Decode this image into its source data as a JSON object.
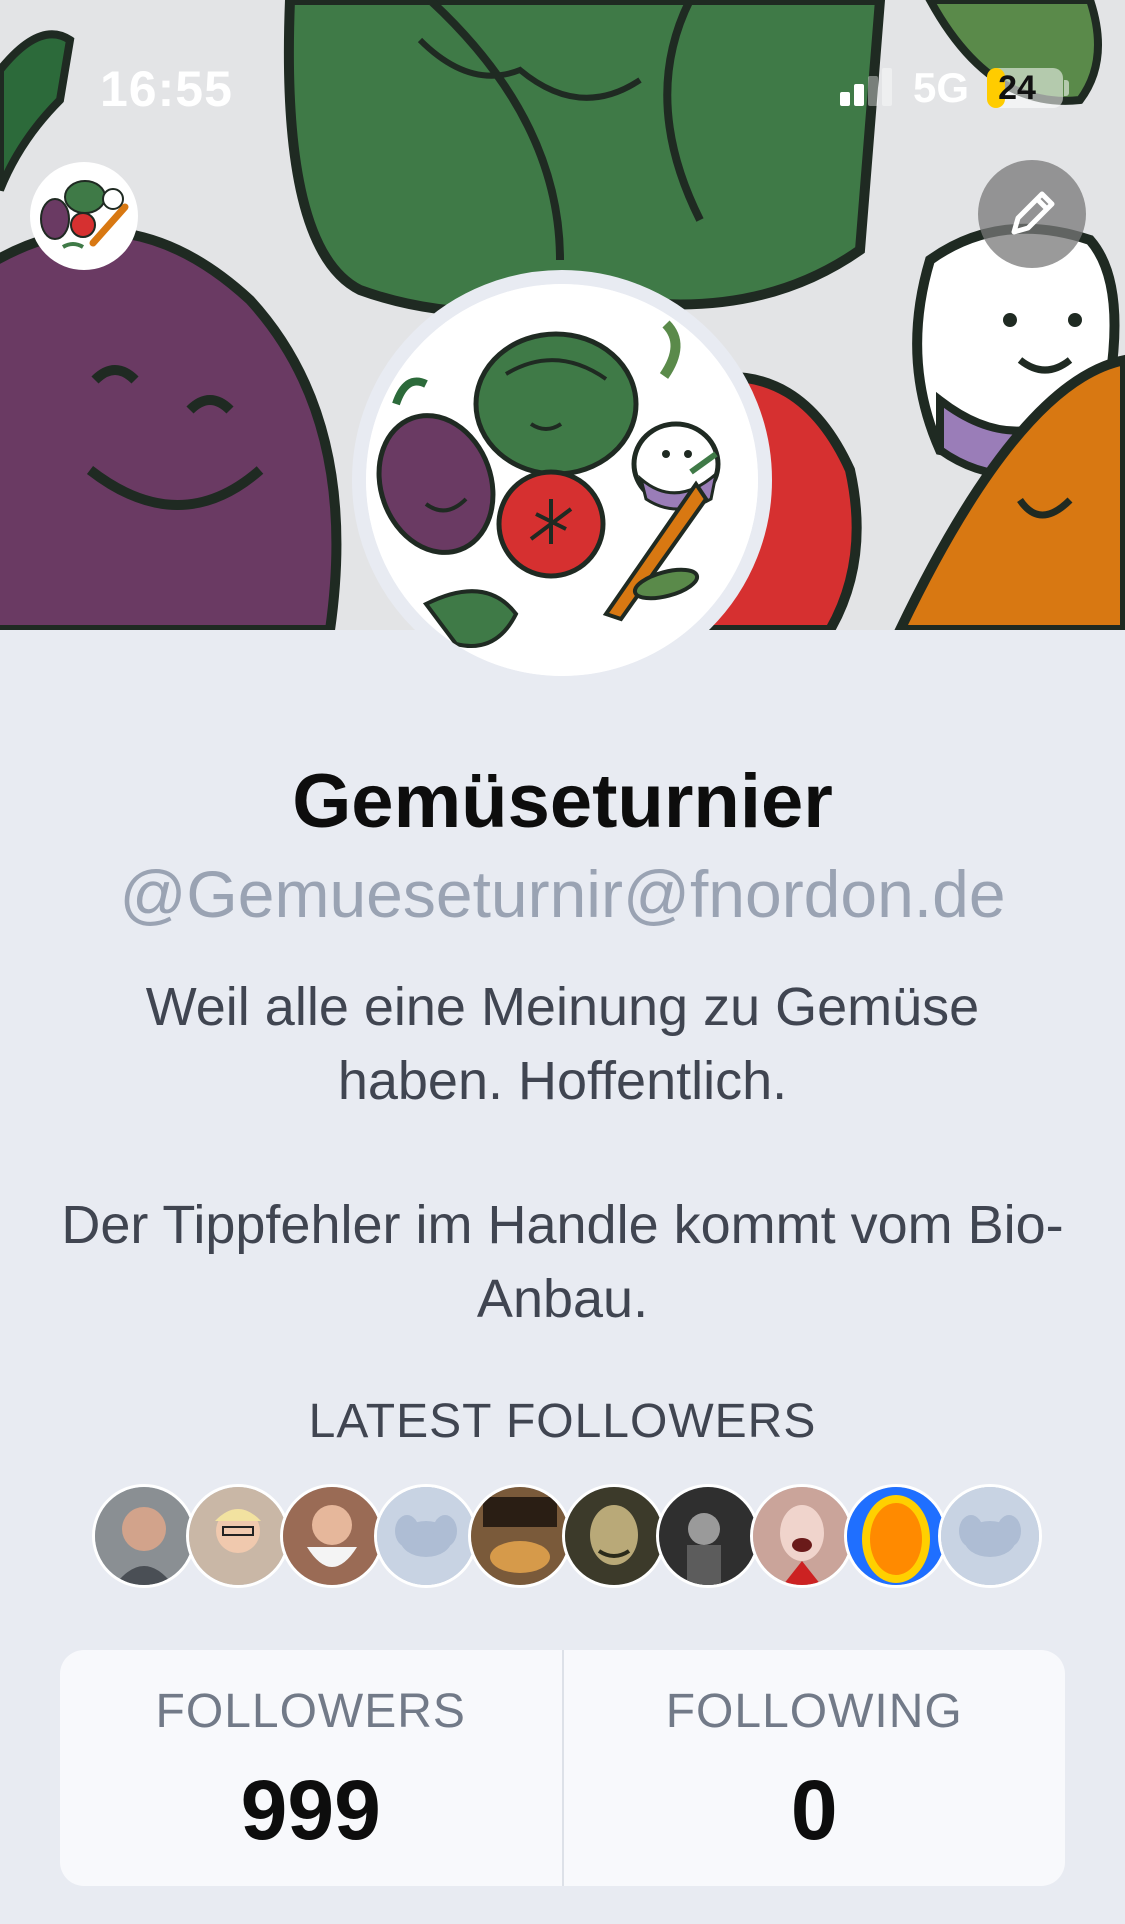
{
  "status_bar": {
    "time": "16:55",
    "network": "5G",
    "battery_level": "24",
    "battery_percent": 24
  },
  "header": {
    "icons": {
      "small_avatar": "vegetable-logo-icon",
      "edit": "pencil-icon"
    }
  },
  "profile": {
    "display_name": "Gemüseturnier",
    "handle": "@Gemueseturnir@fnordon.de",
    "bio_lines": [
      "Weil alle eine Meinung zu Gemüse haben. Hoffentlich.",
      "Der Tippfehler im Handle kommt vom Bio-Anbau."
    ]
  },
  "latest_followers": {
    "heading": "LATEST FOLLOWERS",
    "avatars": [
      {
        "name": "follower-avatar-1",
        "color": "#8a8f93"
      },
      {
        "name": "follower-avatar-2",
        "color": "#c9b7a6"
      },
      {
        "name": "follower-avatar-3",
        "color": "#9a6b55"
      },
      {
        "name": "follower-avatar-4-default",
        "color": "#c8d3e3"
      },
      {
        "name": "follower-avatar-5",
        "color": "#7a5a3a"
      },
      {
        "name": "follower-avatar-6",
        "color": "#3c3a2a"
      },
      {
        "name": "follower-avatar-7",
        "color": "#2f2f2f"
      },
      {
        "name": "follower-avatar-8",
        "color": "#caa49a"
      },
      {
        "name": "follower-avatar-9",
        "color": "#ff8a00"
      },
      {
        "name": "follower-avatar-10-default",
        "color": "#c8d3e3"
      }
    ]
  },
  "stats": {
    "followers_label": "FOLLOWERS",
    "followers_value": "999",
    "following_label": "FOLLOWING",
    "following_value": "0"
  },
  "colors": {
    "background": "#e8ebf2",
    "handle": "#9aa3b3",
    "battery_accent": "#ffcc00"
  }
}
